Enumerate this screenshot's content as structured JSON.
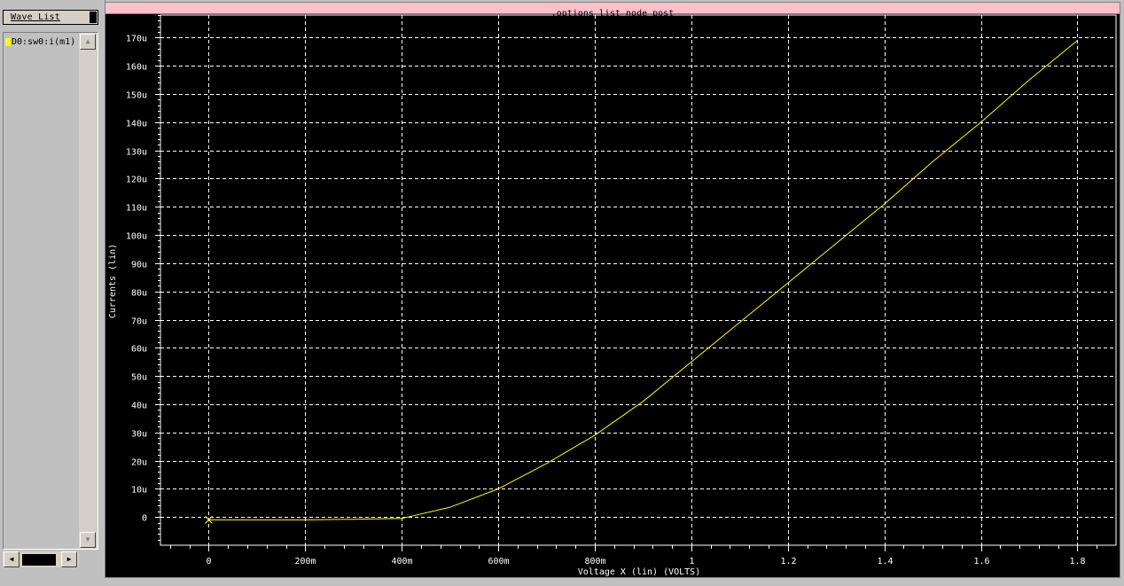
{
  "wave_list": {
    "header": "Wave List",
    "items": [
      {
        "label": "D0:sw0:i(m1)",
        "color": "#ffff00"
      }
    ]
  },
  "plot_window": {
    "title": ".options list node post"
  },
  "chart_data": {
    "type": "line",
    "xlabel": "Voltage X (lin) (VOLTS)",
    "ylabel": "Currents (lin)",
    "xlim": [
      -0.1,
      1.88
    ],
    "ylim": [
      -10,
      178
    ],
    "x_ticks": [
      {
        "value": 0,
        "label": "0"
      },
      {
        "value": 0.2,
        "label": "200m"
      },
      {
        "value": 0.4,
        "label": "400m"
      },
      {
        "value": 0.6,
        "label": "600m"
      },
      {
        "value": 0.8,
        "label": "800m"
      },
      {
        "value": 1.0,
        "label": "1"
      },
      {
        "value": 1.2,
        "label": "1.2"
      },
      {
        "value": 1.4,
        "label": "1.4"
      },
      {
        "value": 1.6,
        "label": "1.6"
      },
      {
        "value": 1.8,
        "label": "1.8"
      }
    ],
    "y_ticks": [
      {
        "value": 0,
        "label": "0"
      },
      {
        "value": 10,
        "label": "10u"
      },
      {
        "value": 20,
        "label": "20u"
      },
      {
        "value": 30,
        "label": "30u"
      },
      {
        "value": 40,
        "label": "40u"
      },
      {
        "value": 50,
        "label": "50u"
      },
      {
        "value": 60,
        "label": "60u"
      },
      {
        "value": 70,
        "label": "70u"
      },
      {
        "value": 80,
        "label": "80u"
      },
      {
        "value": 90,
        "label": "90u"
      },
      {
        "value": 100,
        "label": "100u"
      },
      {
        "value": 110,
        "label": "110u"
      },
      {
        "value": 120,
        "label": "120u"
      },
      {
        "value": 130,
        "label": "130u"
      },
      {
        "value": 140,
        "label": "140u"
      },
      {
        "value": 150,
        "label": "150u"
      },
      {
        "value": 160,
        "label": "160u"
      },
      {
        "value": 170,
        "label": "170u"
      }
    ],
    "grid": true,
    "series": [
      {
        "name": "D0:sw0:i(m1)",
        "color": "#ffff00",
        "x": [
          0,
          0.1,
          0.2,
          0.3,
          0.4,
          0.5,
          0.6,
          0.7,
          0.8,
          0.9,
          1.0,
          1.1,
          1.2,
          1.3,
          1.4,
          1.5,
          1.6,
          1.7,
          1.8
        ],
        "y": [
          -1,
          -1,
          -1,
          -0.8,
          -0.5,
          3.5,
          10,
          19,
          29,
          41,
          55,
          69,
          83,
          97,
          111,
          126,
          140,
          155,
          169
        ]
      }
    ],
    "marker": {
      "x": 0,
      "y": -1,
      "symbol": "x"
    }
  }
}
